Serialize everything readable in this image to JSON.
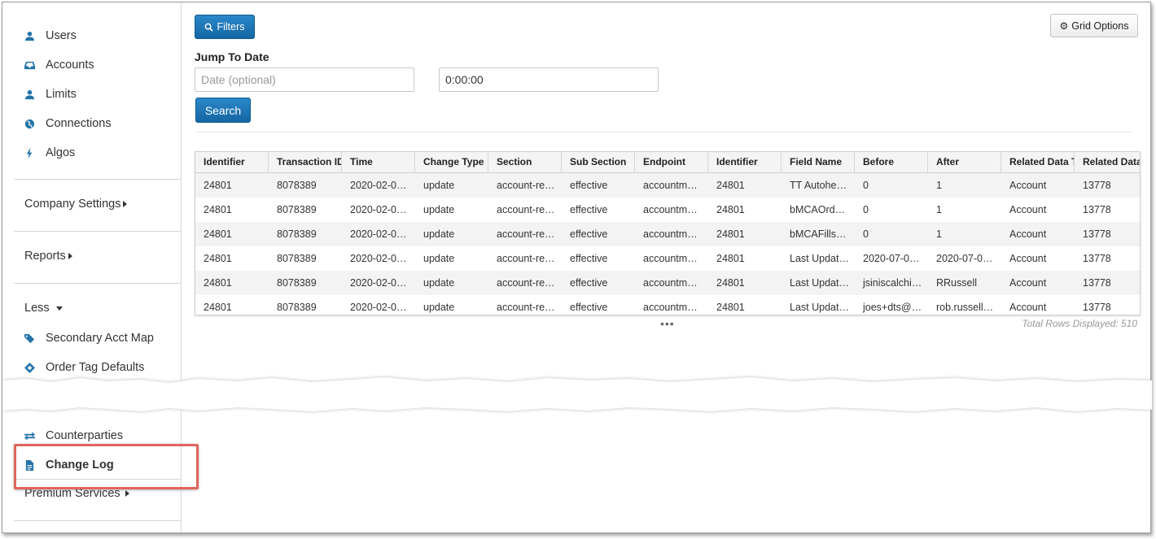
{
  "sidebar": {
    "items": [
      {
        "label": "Users",
        "icon": "user-icon"
      },
      {
        "label": "Accounts",
        "icon": "inbox-icon"
      },
      {
        "label": "Limits",
        "icon": "user-icon"
      },
      {
        "label": "Connections",
        "icon": "globe-icon"
      },
      {
        "label": "Algos",
        "icon": "bolt-icon"
      }
    ],
    "company_settings": "Company Settings",
    "reports": "Reports",
    "less": "Less",
    "secondary_acct_map": "Secondary Acct Map",
    "order_tag_defaults": "Order Tag Defaults",
    "counterparties": "Counterparties",
    "change_log": "Change Log",
    "premium_services": "Premium Services"
  },
  "toolbar": {
    "filters_label": "Filters",
    "grid_options_label": "Grid Options"
  },
  "jump_to_date": {
    "label": "Jump To Date",
    "date_placeholder": "Date (optional)",
    "time_value": "0:00:00",
    "search_label": "Search"
  },
  "grid": {
    "columns": [
      "Identifier",
      "Transaction ID",
      "Time",
      "Change Type",
      "Section",
      "Sub Section",
      "Endpoint",
      "Identifier",
      "Field Name",
      "Before",
      "After",
      "Related Data Ty",
      "Related Data"
    ],
    "rows": [
      [
        "24801",
        "8078389",
        "2020-02-0…",
        "update",
        "account-re…",
        "effective",
        "accountm…",
        "24801",
        "TT Autohe…",
        "0",
        "1",
        "Account",
        "13778"
      ],
      [
        "24801",
        "8078389",
        "2020-02-0…",
        "update",
        "account-re…",
        "effective",
        "accountm…",
        "24801",
        "bMCAOrd…",
        "0",
        "1",
        "Account",
        "13778"
      ],
      [
        "24801",
        "8078389",
        "2020-02-0…",
        "update",
        "account-re…",
        "effective",
        "accountm…",
        "24801",
        "bMCAFills…",
        "0",
        "1",
        "Account",
        "13778"
      ],
      [
        "24801",
        "8078389",
        "2020-02-0…",
        "update",
        "account-re…",
        "effective",
        "accountm…",
        "24801",
        "Last Updat…",
        "2020-07-0…",
        "2020-07-0…",
        "Account",
        "13778"
      ],
      [
        "24801",
        "8078389",
        "2020-02-0…",
        "update",
        "account-re…",
        "effective",
        "accountm…",
        "24801",
        "Last Updat…",
        "jsiniscalchi…",
        "RRussell",
        "Account",
        "13778"
      ],
      [
        "24801",
        "8078389",
        "2020-02-0…",
        "update",
        "account-re…",
        "effective",
        "accountm…",
        "24801",
        "Last Updat…",
        "joes+dts@…",
        "rob.russell…",
        "Account",
        "13778"
      ]
    ],
    "more_indicator": "•••",
    "total_rows": "Total Rows Displayed: 510"
  },
  "colors": {
    "accent": "#1a73b6",
    "highlight": "#e0655c"
  }
}
